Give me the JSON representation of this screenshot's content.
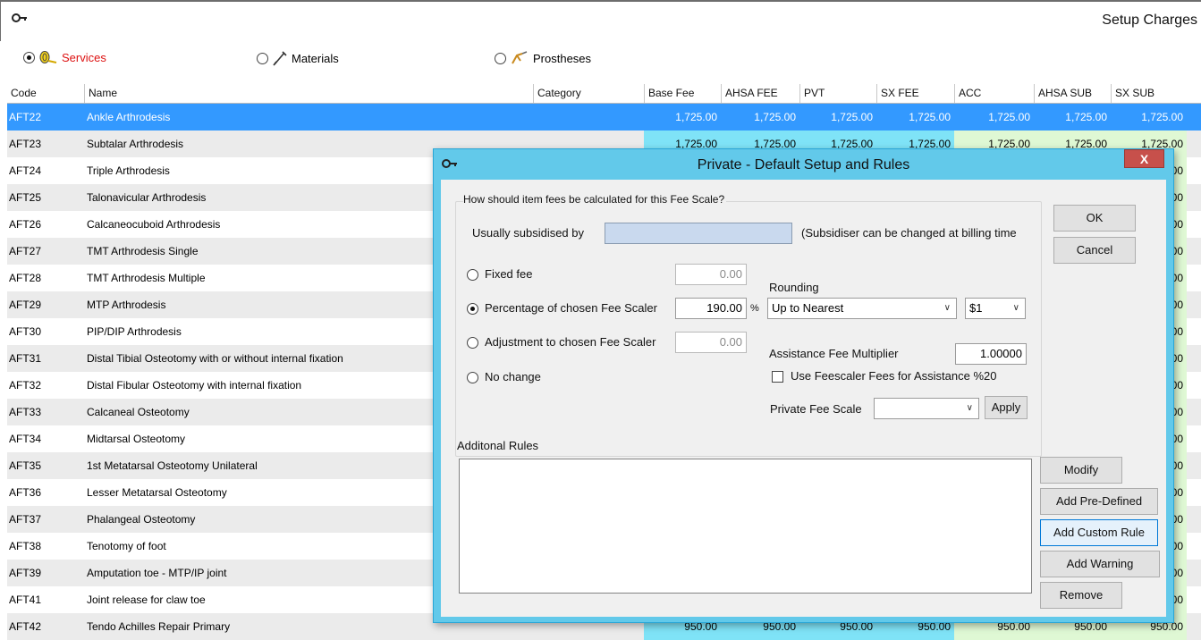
{
  "window": {
    "title": "Setup Charges",
    "key_icon": "key-icon"
  },
  "modes": [
    {
      "label": "Services",
      "selected": true,
      "icon": "services-icon"
    },
    {
      "label": "Materials",
      "selected": false,
      "icon": "materials-icon"
    },
    {
      "label": "Prostheses",
      "selected": false,
      "icon": "prostheses-icon"
    }
  ],
  "grid": {
    "headers": [
      "Code",
      "Name",
      "Category",
      "Base Fee",
      "AHSA FEE",
      "PVT",
      "SX FEE",
      "ACC",
      "AHSA SUB",
      "SX SUB"
    ],
    "rows": [
      {
        "code": "AFT22",
        "name": "Ankle Arthrodesis",
        "fee": "1,725.00",
        "selected": true
      },
      {
        "code": "AFT23",
        "name": "Subtalar Arthrodesis",
        "fee": "1,725.00"
      },
      {
        "code": "AFT24",
        "name": "Triple Arthrodesis",
        "fee": ""
      },
      {
        "code": "AFT25",
        "name": "Talonavicular Arthrodesis",
        "fee": ""
      },
      {
        "code": "AFT26",
        "name": "Calcaneocuboid Arthrodesis",
        "fee": ""
      },
      {
        "code": "AFT27",
        "name": "TMT  Arthrodesis Single",
        "fee": ""
      },
      {
        "code": "AFT28",
        "name": "TMT  Arthrodesis Multiple",
        "fee": ""
      },
      {
        "code": "AFT29",
        "name": "MTP Arthrodesis",
        "fee": ""
      },
      {
        "code": "AFT30",
        "name": "PIP/DIP Arthrodesis",
        "fee": ""
      },
      {
        "code": "AFT31",
        "name": "Distal Tibial Osteotomy with or without internal fixation",
        "fee": ""
      },
      {
        "code": "AFT32",
        "name": "Distal Fibular Osteotomy with internal fixation",
        "fee": ""
      },
      {
        "code": "AFT33",
        "name": "Calcaneal Osteotomy",
        "fee": ""
      },
      {
        "code": "AFT34",
        "name": "Midtarsal Osteotomy",
        "fee": ""
      },
      {
        "code": "AFT35",
        "name": "1st Metatarsal Osteotomy Unilateral",
        "fee": ""
      },
      {
        "code": "AFT36",
        "name": "Lesser Metatarsal Osteotomy",
        "fee": ""
      },
      {
        "code": "AFT37",
        "name": "Phalangeal Osteotomy",
        "fee": ""
      },
      {
        "code": "AFT38",
        "name": "Tenotomy of foot",
        "fee": ""
      },
      {
        "code": "AFT39",
        "name": "Amputation toe - MTP/IP joint",
        "fee": ""
      },
      {
        "code": "AFT41",
        "name": "Joint release for claw toe",
        "fee": ""
      },
      {
        "code": "AFT42",
        "name": "Tendo Achilles Repair Primary",
        "fee": "950.00"
      }
    ],
    "visible_right_edge_value": "00"
  },
  "dialog": {
    "title": "Private - Default Setup and Rules",
    "close_label": "X",
    "group_caption": "How should item fees be calculated for this Fee Scale?",
    "subsidised_label": "Usually subsidised by",
    "subsidised_value": "",
    "subsidised_note": "(Subsidiser can be changed at billing time",
    "options": {
      "fixed_fee": {
        "label": "Fixed fee",
        "value": "0.00",
        "selected": false
      },
      "percentage": {
        "label": "Percentage of chosen Fee Scaler",
        "value": "190.00",
        "unit": "%",
        "selected": true
      },
      "adjustment": {
        "label": "Adjustment to chosen Fee Scaler",
        "value": "0.00",
        "selected": false
      },
      "no_change": {
        "label": "No change",
        "selected": false
      }
    },
    "rounding_label": "Rounding",
    "rounding_value": "Up to Nearest",
    "rounding_unit": "$1",
    "assistance_label": "Assistance Fee Multiplier",
    "assistance_value": "1.00000",
    "feescaler_checkbox": {
      "label": "Use Feescaler Fees for Assistance %20",
      "checked": false
    },
    "private_fee_scale_label": "Private Fee Scale",
    "private_fee_scale_value": "",
    "apply_label": "Apply",
    "ok_label": "OK",
    "cancel_label": "Cancel",
    "rules_label": "Additonal Rules",
    "rule_buttons": {
      "modify": "Modify",
      "add_predefined": "Add Pre-Defined",
      "add_custom": "Add Custom Rule",
      "add_warning": "Add Warning",
      "remove": "Remove"
    }
  },
  "colors": {
    "selected_row": "#3399ff",
    "fee_cyan": "#7fe3f7",
    "fee_green": "#dff8d4",
    "dialog_frame": "#62c9ea",
    "close_red": "#c7504b"
  }
}
